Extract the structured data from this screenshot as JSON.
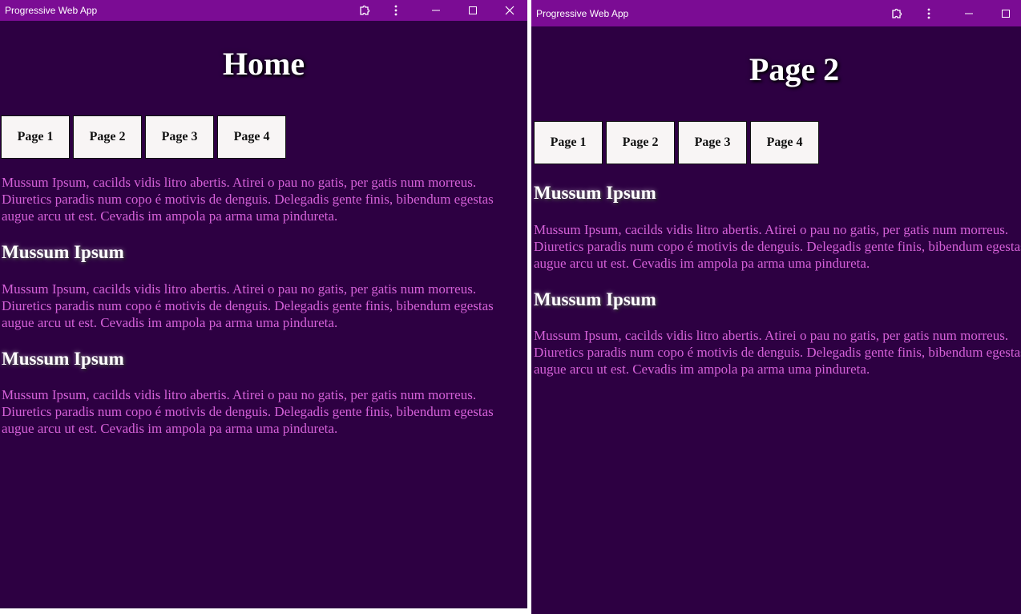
{
  "left_window": {
    "title": "Progressive Web App",
    "page_heading": "Home",
    "nav": [
      "Page 1",
      "Page 2",
      "Page 3",
      "Page 4"
    ],
    "intro": [
      "Mussum Ipsum, cacilds vidis litro abertis. Atirei o pau no gatis, per gatis num morreus.",
      "Diuretics paradis num copo é motivis de denguis. Delegadis gente finis, bibendum egestas",
      "augue arcu ut est. Cevadis im ampola pa arma uma pindureta."
    ],
    "sections": [
      {
        "heading": "Mussum Ipsum",
        "lines": [
          "Mussum Ipsum, cacilds vidis litro abertis. Atirei o pau no gatis, per gatis num morreus.",
          "Diuretics paradis num copo é motivis de denguis. Delegadis gente finis, bibendum egestas",
          "augue arcu ut est. Cevadis im ampola pa arma uma pindureta."
        ]
      },
      {
        "heading": "Mussum Ipsum",
        "lines": [
          "Mussum Ipsum, cacilds vidis litro abertis. Atirei o pau no gatis, per gatis num morreus.",
          "Diuretics paradis num copo é motivis de denguis. Delegadis gente finis, bibendum egestas",
          "augue arcu ut est. Cevadis im ampola pa arma uma pindureta."
        ]
      }
    ]
  },
  "right_window": {
    "title": "Progressive Web App",
    "page_heading": "Page 2",
    "nav": [
      "Page 1",
      "Page 2",
      "Page 3",
      "Page 4"
    ],
    "sections": [
      {
        "heading": "Mussum Ipsum",
        "lines": [
          "Mussum Ipsum, cacilds vidis litro abertis. Atirei o pau no gatis, per gatis num morreus.",
          "Diuretics paradis num copo é motivis de denguis. Delegadis gente finis, bibendum egestas",
          "augue arcu ut est. Cevadis im ampola pa arma uma pindureta."
        ]
      },
      {
        "heading": "Mussum Ipsum",
        "lines": [
          "Mussum Ipsum, cacilds vidis litro abertis. Atirei o pau no gatis, per gatis num morreus.",
          "Diuretics paradis num copo é motivis de denguis. Delegadis gente finis, bibendum egestas",
          "augue arcu ut est. Cevadis im ampola pa arma uma pindureta."
        ]
      }
    ]
  },
  "colors": {
    "titlebar": "#7b0c94",
    "background": "#2d0042",
    "body_text": "#d561d8",
    "heading_text": "#ffffff",
    "nav_button": "#f8f5f5"
  },
  "icons": [
    "extension-icon",
    "more-vert-icon",
    "minimize-icon",
    "maximize-icon",
    "close-icon"
  ]
}
